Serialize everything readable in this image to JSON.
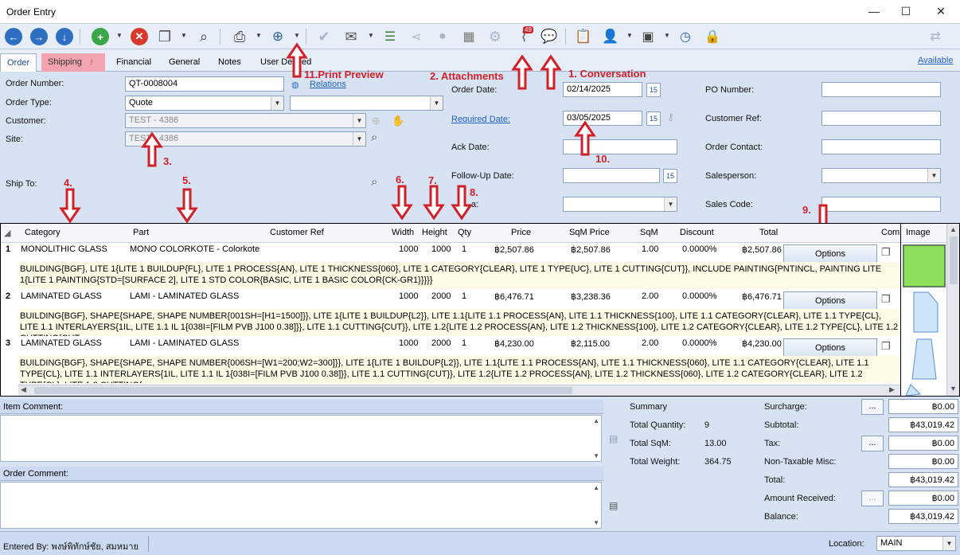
{
  "window": {
    "title": "Order Entry"
  },
  "tabs": {
    "items": [
      "Order",
      "Shipping",
      "Financial",
      "General",
      "Notes",
      "User Defined"
    ],
    "shipping_badge": "!",
    "available_link": "Available"
  },
  "toolbar": {
    "attachments_count": "49"
  },
  "annotations": {
    "a1": "1. Conversation",
    "a2": "2. Attachments",
    "a3": "3.",
    "a4": "4.",
    "a5": "5.",
    "a6": "6.",
    "a7": "7.",
    "a8": "8.",
    "a9": "9.",
    "a10": "10.",
    "a11": "11.Print Preview"
  },
  "form": {
    "order_number_label": "Order Number:",
    "order_number": "QT-0008004",
    "relations_link": "Relations",
    "order_type_label": "Order Type:",
    "order_type": "Quote",
    "customer_label": "Customer:",
    "customer": "TEST - 4386",
    "site_label": "Site:",
    "site": "TEST - 4386",
    "ship_to_label": "Ship To:",
    "order_date_label": "Order Date:",
    "order_date": "02/14/2025",
    "required_date_label": "Required Date:",
    "required_date": "03/05/2025",
    "ack_date_label": "Ack Date:",
    "ack_date": "",
    "followup_date_label": "Follow-Up Date:",
    "followup_date": "",
    "partial_label": "a:",
    "cal_label": "15",
    "po_number_label": "PO Number:",
    "po_number": "",
    "customer_ref_label": "Customer Ref:",
    "customer_ref": "",
    "order_contact_label": "Order Contact:",
    "order_contact": "",
    "salesperson_label": "Salesperson:",
    "salesperson": "",
    "sales_code_label": "Sales Code:",
    "sales_code": ""
  },
  "grid": {
    "headers": {
      "category": "Category",
      "part": "Part",
      "customer_ref": "Customer Ref",
      "width": "Width",
      "height": "Height",
      "qty": "Qty",
      "price": "Price",
      "sqm_price": "SqM Price",
      "sqm": "SqM",
      "discount": "Discount",
      "total": "Total",
      "comment": "Com",
      "image": "Image"
    },
    "options_label": "Options",
    "rows": [
      {
        "num": "1",
        "category": "MONOLITHIC GLASS",
        "part": "MONO COLORKOTE - Colorkote",
        "width": "1000",
        "height": "1000",
        "qty": "1",
        "price": "฿2,507.86",
        "sqm_price": "฿2,507.86",
        "sqm": "1.00",
        "discount": "0.0000%",
        "total": "฿2,507.86",
        "desc": "BUILDING{BGF}, LITE 1{LITE 1 BUILDUP{FL}, LITE 1 PROCESS{AN}, LITE 1 THICKNESS{060}, LITE 1 CATEGORY{CLEAR}, LITE 1 TYPE{UC}, LITE 1 CUTTING{CUT}}, INCLUDE PAINTING{PNTINCL, PAINTING LITE 1{LITE 1 PAINTING{STD=[SURFACE 2], LITE 1 STD COLOR{BASIC, LITE 1 BASIC COLOR{CK-GR1}}}}}"
      },
      {
        "num": "2",
        "category": "LAMINATED GLASS",
        "part": "LAMI - LAMINATED GLASS",
        "width": "1000",
        "height": "2000",
        "qty": "1",
        "price": "฿6,476.71",
        "sqm_price": "฿3,238.36",
        "sqm": "2.00",
        "discount": "0.0000%",
        "total": "฿6,476.71",
        "desc": "BUILDING{BGF}, SHAPE{SHAPE, SHAPE NUMBER{001SH=[H1=1500]}}, LITE 1{LITE 1 BUILDUP{L2}}, LITE 1.1{LITE 1.1 PROCESS{AN}, LITE 1.1 THICKNESS{100}, LITE 1.1 CATEGORY{CLEAR}, LITE 1.1 TYPE{CL}, LITE 1.1 INTERLAYERS{1IL, LITE 1.1 IL 1{038I=[FILM PVB J100 0.38]}}, LITE 1.1 CUTTING{CUT}}, LITE 1.2{LITE 1.2 PROCESS{AN}, LITE 1.2 THICKNESS{100}, LITE 1.2 CATEGORY{CLEAR}, LITE 1.2 TYPE{CL}, LITE 1.2 CUTTING{CUT..."
      },
      {
        "num": "3",
        "category": "LAMINATED GLASS",
        "part": "LAMI - LAMINATED GLASS",
        "width": "1000",
        "height": "2000",
        "qty": "1",
        "price": "฿4,230.00",
        "sqm_price": "฿2,115.00",
        "sqm": "2.00",
        "discount": "0.0000%",
        "total": "฿4,230.00",
        "desc": "BUILDING{BGF}, SHAPE{SHAPE, SHAPE NUMBER{006SH=[W1=200;W2=300]}}, LITE 1{LITE 1 BUILDUP{L2}}, LITE 1.1{LITE 1.1 PROCESS{AN}, LITE 1.1 THICKNESS{060}, LITE 1.1 CATEGORY{CLEAR}, LITE 1.1 TYPE{CL}, LITE 1.1 INTERLAYERS{1IL, LITE 1.1 IL 1{038I=[FILM PVB J100 0.38]}}, LITE 1.1 CUTTING{CUT}}, LITE 1.2{LITE 1.2 PROCESS{AN}, LITE 1.2 THICKNESS{060}, LITE 1.2 CATEGORY{CLEAR}, LITE 1.2 TYPE{CL}, LITE 1.2 CUTTING{..."
      }
    ]
  },
  "bottom": {
    "item_comment_label": "Item Comment:",
    "order_comment_label": "Order Comment:",
    "summary_label": "Summary",
    "total_quantity_label": "Total Quantity:",
    "total_quantity": "9",
    "total_sqm_label": "Total SqM:",
    "total_sqm": "13.00",
    "total_weight_label": "Total Weight:",
    "total_weight": "364.75",
    "surcharge_label": "Surcharge:",
    "surcharge": "฿0.00",
    "subtotal_label": "Subtotal:",
    "subtotal": "฿43,019.42",
    "tax_label": "Tax:",
    "tax": "฿0.00",
    "nontax_label": "Non-Taxable Misc:",
    "nontax": "฿0.00",
    "total_label": "Total:",
    "total": "฿43,019.42",
    "amount_received_label": "Amount Received:",
    "amount_received": "฿0.00",
    "balance_label": "Balance:",
    "balance": "฿43,019.42",
    "dots": "..."
  },
  "status": {
    "entered_by": "Entered By: พงษ์พิทักษ์ชัย, สมหมาย",
    "location_label": "Location:",
    "location": "MAIN"
  }
}
